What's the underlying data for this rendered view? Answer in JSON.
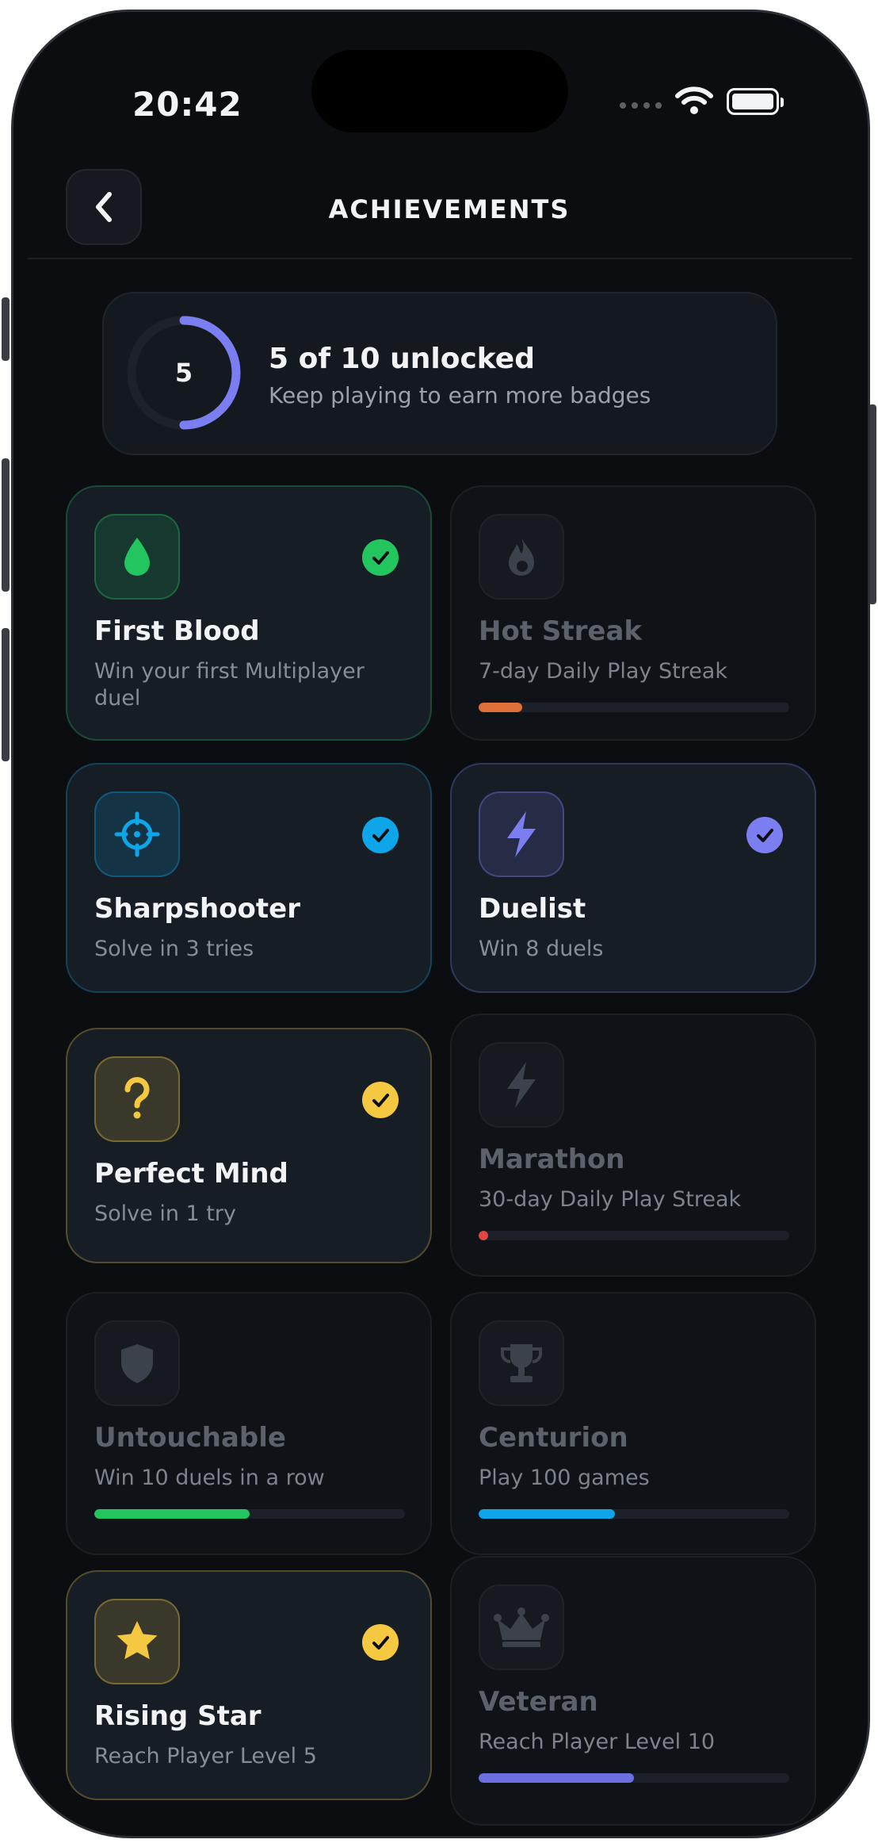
{
  "status_bar": {
    "time": "20:42"
  },
  "header": {
    "title": "ACHIEVEMENTS",
    "back_icon": "chevron-left-icon"
  },
  "summary": {
    "count": "5",
    "title": "5 of 10 unlocked",
    "subtitle": "Keep playing to earn more badges",
    "progress": 0.5,
    "ring_color": "#7b7ef0"
  },
  "achievements": [
    {
      "name": "First Blood",
      "description": "Win your first Multiplayer duel",
      "unlocked": true,
      "icon": "drop-icon",
      "accent": "#22c55e"
    },
    {
      "name": "Hot Streak",
      "description": "7-day Daily Play Streak",
      "unlocked": false,
      "icon": "flame-icon",
      "accent": "#e0703a",
      "progress": 0.14
    },
    {
      "name": "Sharpshooter",
      "description": "Solve in 3 tries",
      "unlocked": true,
      "icon": "crosshair-icon",
      "accent": "#0ea5e9"
    },
    {
      "name": "Duelist",
      "description": "Win 8 duels",
      "unlocked": true,
      "icon": "lightning-icon",
      "accent": "#7b7ef0"
    },
    {
      "name": "Perfect Mind",
      "description": "Solve in 1 try",
      "unlocked": true,
      "icon": "question-icon",
      "accent": "#f5c842"
    },
    {
      "name": "Marathon",
      "description": "30-day Daily Play Streak",
      "unlocked": false,
      "icon": "lightning-icon",
      "accent": "#e04646",
      "progress": 0.03
    },
    {
      "name": "Untouchable",
      "description": "Win 10 duels in a row",
      "unlocked": false,
      "icon": "shield-icon",
      "accent": "#22c55e",
      "progress": 0.5
    },
    {
      "name": "Centurion",
      "description": "Play 100 games",
      "unlocked": false,
      "icon": "trophy-icon",
      "accent": "#0ea5e9",
      "progress": 0.44
    },
    {
      "name": "Rising Star",
      "description": "Reach Player Level 5",
      "unlocked": true,
      "icon": "star-icon",
      "accent": "#f5c842"
    },
    {
      "name": "Veteran",
      "description": "Reach Player Level 10",
      "unlocked": false,
      "icon": "crown-icon",
      "accent": "#6b6fe0",
      "progress": 0.5
    }
  ]
}
